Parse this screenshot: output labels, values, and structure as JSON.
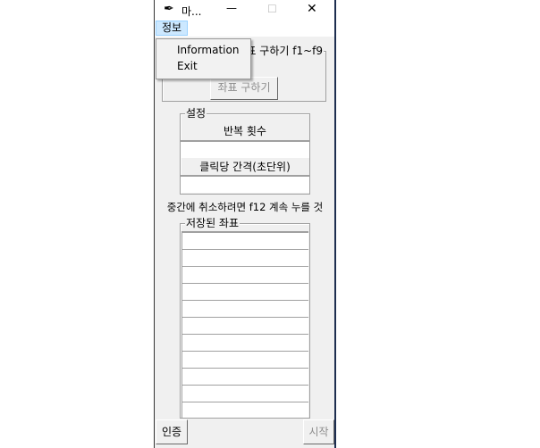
{
  "window": {
    "title": "마...",
    "minimize": "—",
    "maximize": "☐",
    "close": "✕",
    "icon": "feather-icon"
  },
  "menubar": {
    "menu": "정보",
    "items": [
      "Information",
      "Exit"
    ]
  },
  "coords_group": {
    "label": "좌표 구하기 f1~f9",
    "button": "좌표 구하기"
  },
  "settings": {
    "label": "설정",
    "repeat_label": "반복 횟수",
    "repeat_value": "",
    "interval_label": "클릭당 간격(초단위)",
    "interval_value": ""
  },
  "hint": "중간에 취소하려면 f12 계속 누를 것",
  "saved": {
    "label": "저장된 좌표",
    "rows": [
      "",
      "",
      "",
      "",
      "",
      "",
      "",
      "",
      "",
      "",
      ""
    ]
  },
  "buttons": {
    "auth": "인증",
    "start": "시작"
  }
}
